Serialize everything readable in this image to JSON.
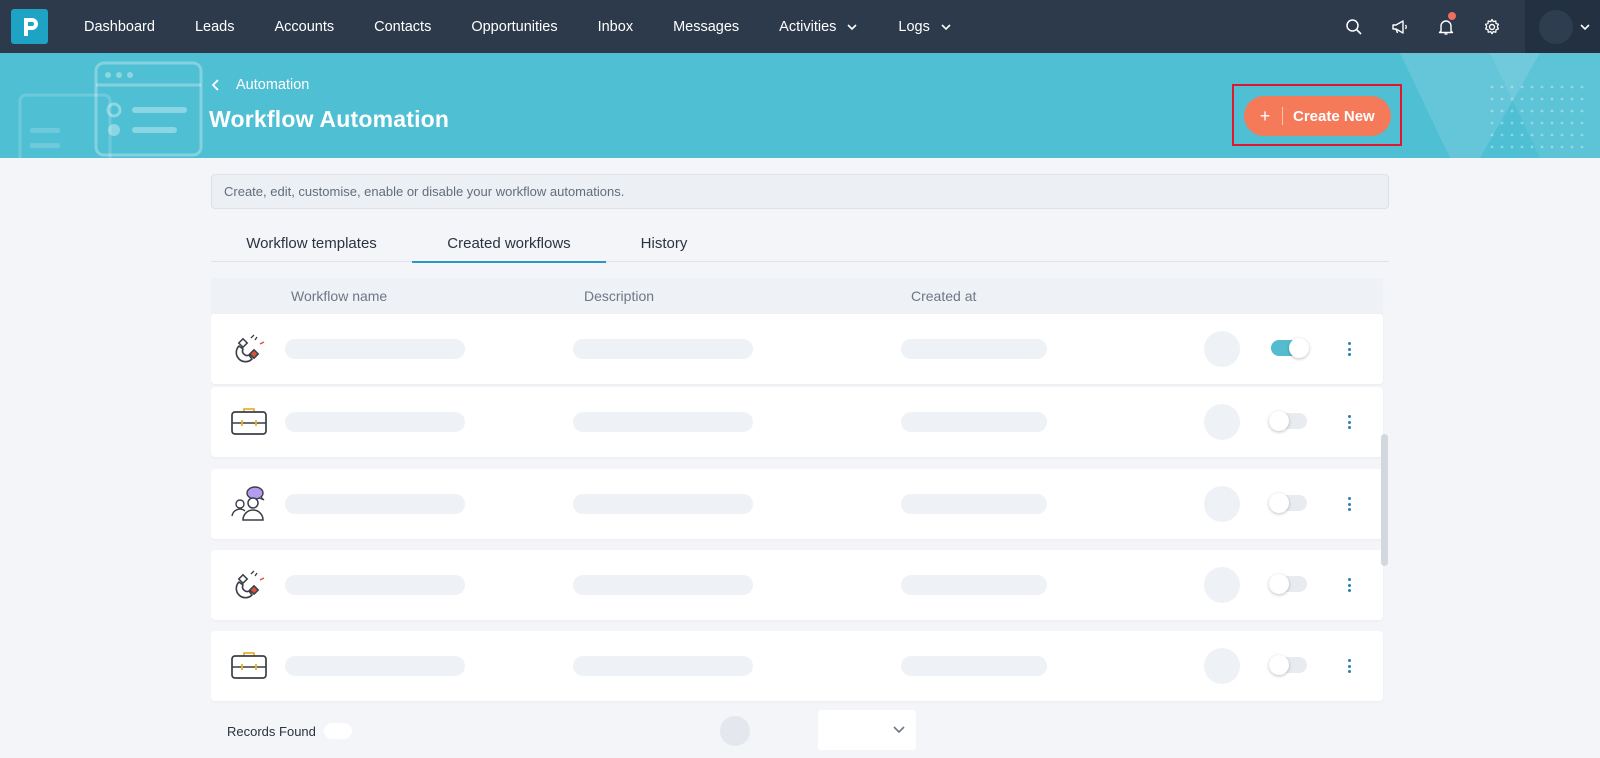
{
  "nav": {
    "items": [
      {
        "label": "Dashboard"
      },
      {
        "label": "Leads"
      },
      {
        "label": "Accounts"
      },
      {
        "label": "Contacts"
      },
      {
        "label": "Opportunities"
      },
      {
        "label": "Inbox"
      },
      {
        "label": "Messages"
      },
      {
        "label": "Activities"
      },
      {
        "label": "Logs"
      }
    ]
  },
  "header": {
    "breadcrumb": "Automation",
    "title": "Workflow Automation",
    "create_label": "Create New",
    "create_plus": "+"
  },
  "description": "Create, edit, customise, enable or disable your workflow automations.",
  "tabs": [
    {
      "label": "Workflow templates"
    },
    {
      "label": "Created workflows",
      "active": true
    },
    {
      "label": "History"
    }
  ],
  "table": {
    "columns": [
      "Workflow name",
      "Description",
      "Created at"
    ],
    "rows": [
      {
        "icon": "magnet-icon",
        "enabled": true
      },
      {
        "icon": "briefcase-icon",
        "enabled": false
      },
      {
        "icon": "contact-chat-icon",
        "enabled": false
      },
      {
        "icon": "magnet-icon",
        "enabled": false
      },
      {
        "icon": "briefcase-icon",
        "enabled": false
      }
    ]
  },
  "footer": {
    "records_label": "Records Found"
  },
  "colors": {
    "nav_bg": "#2c3a4b",
    "banner_bg": "#4fbfd3",
    "accent_button": "#f47a5a",
    "highlight": "#e0182d",
    "toggle_on": "#55bcd0"
  }
}
